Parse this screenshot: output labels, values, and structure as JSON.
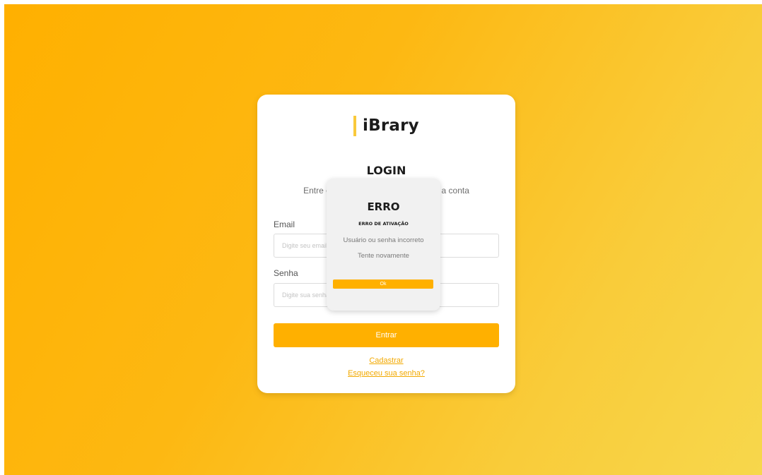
{
  "brand": {
    "name": "iBrary",
    "accent_color": "#ffb000"
  },
  "login": {
    "title": "LOGIN",
    "subtitle": "Entre com seus dados para acessar a conta",
    "email_label": "Email",
    "email_placeholder": "Digite seu email",
    "password_label": "Senha",
    "password_placeholder": "Digite sua senha",
    "submit_label": "Entrar",
    "register_link": "Cadastrar",
    "forgot_link": "Esqueceu sua senha?"
  },
  "error_modal": {
    "title": "ERRO",
    "heading": "ERRO DE ATIVAÇÃO",
    "message": "Usuário ou senha incorreto",
    "hint": "Tente novamente",
    "ok_label": "Ok"
  }
}
